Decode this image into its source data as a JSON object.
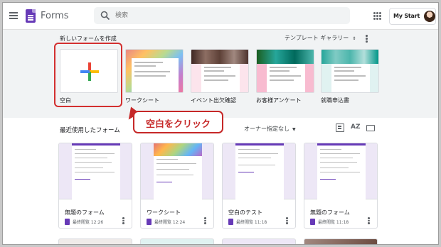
{
  "header": {
    "app_title": "Forms",
    "search_placeholder": "検索",
    "account_badge": "My Start"
  },
  "gallery": {
    "title": "新しいフォームを作成",
    "gallery_button": "テンプレート ギャラリー",
    "templates": [
      {
        "label": "空白"
      },
      {
        "label": "ワークシート"
      },
      {
        "label": "イベント出欠確認"
      },
      {
        "label": "お客様アンケート"
      },
      {
        "label": "就職申込書"
      }
    ]
  },
  "callout": {
    "text": "空白をクリック"
  },
  "recent": {
    "title": "最近使用したフォーム",
    "owner_filter": "オーナー指定なし",
    "sort_icon_text": "AZ",
    "forms": [
      {
        "title": "無題のフォーム",
        "meta": "最終閲覧 12:26"
      },
      {
        "title": "ワークシート",
        "meta": "最終閲覧 12:24"
      },
      {
        "title": "空白のテスト",
        "meta": "最終閲覧 11:18"
      },
      {
        "title": "無題のフォーム",
        "meta": "最終閲覧 11:18"
      }
    ]
  },
  "colors": {
    "forms_purple": "#673ab7",
    "callout_red": "#c62828",
    "gallery_bg": "#f1f3f4"
  },
  "icons": [
    "menu-icon",
    "forms-logo-icon",
    "search-icon",
    "apps-icon",
    "more-vert-icon",
    "list-view-icon",
    "sort-az-icon",
    "folder-icon",
    "plus-icon"
  ]
}
